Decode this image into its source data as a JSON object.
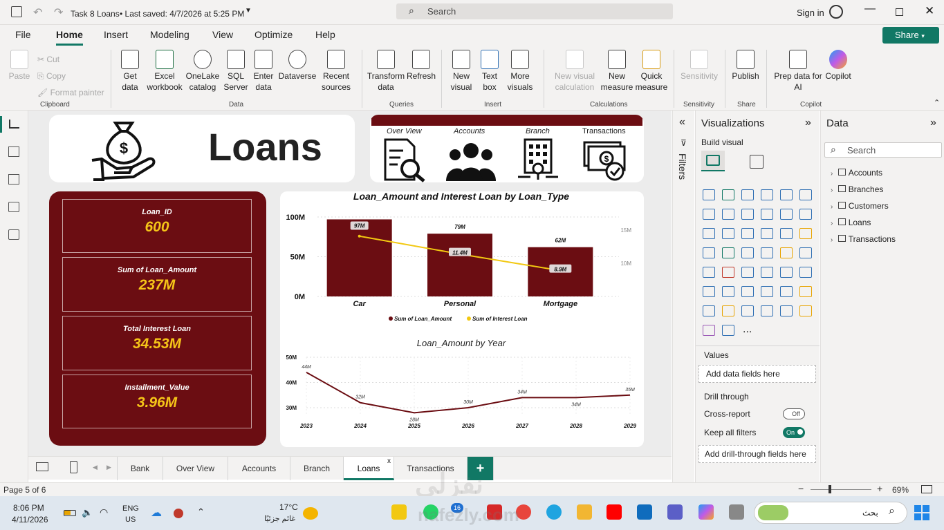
{
  "titlebar": {
    "title": "Task 8 Loans",
    "saved": "• Last saved: 4/7/2026 at 5:25 PM",
    "search": "Search",
    "signin": "Sign in"
  },
  "menu": {
    "items": [
      "File",
      "Home",
      "Insert",
      "Modeling",
      "View",
      "Optimize",
      "Help"
    ],
    "share": "Share"
  },
  "ribbon": {
    "clipboard": {
      "paste": "Paste",
      "cut": "Cut",
      "copy": "Copy",
      "format_painter": "Format painter",
      "group": "Clipboard"
    },
    "data": {
      "get_data": "Get data",
      "excel": "Excel workbook",
      "onelake": "OneLake catalog",
      "sql": "SQL Server",
      "enter": "Enter data",
      "dataverse": "Dataverse",
      "recent": "Recent sources",
      "group": "Data"
    },
    "queries": {
      "transform": "Transform data",
      "refresh": "Refresh",
      "group": "Queries"
    },
    "insert": {
      "new_visual": "New visual",
      "text_box": "Text box",
      "more_visuals": "More visuals",
      "group": "Insert"
    },
    "calculations": {
      "new_visual_calc": "New visual calculation",
      "new_measure": "New measure",
      "quick_measure": "Quick measure",
      "group": "Calculations"
    },
    "sensitivity": {
      "label": "Sensitivity",
      "group": "Sensitivity"
    },
    "share": {
      "publish": "Publish",
      "group": "Share"
    },
    "copilot": {
      "prep": "Prep data for AI",
      "copilot": "Copilot",
      "group": "Copilot"
    }
  },
  "report": {
    "title": "Loans",
    "nav": {
      "bar_color": "#6b0d12",
      "items": [
        "Over View",
        "Accounts",
        "Branch",
        "Transactions"
      ]
    },
    "cards": [
      {
        "label": "Loan_ID",
        "value": "600"
      },
      {
        "label": "Sum of Loan_Amount",
        "value": "237M"
      },
      {
        "label": "Total Interest Loan",
        "value": "34.53M"
      },
      {
        "label": "Installment_Value",
        "value": "3.96M"
      }
    ]
  },
  "chart_data": [
    {
      "type": "bar",
      "title": "Loan_Amount and Interest Loan by Loan_Type",
      "categories": [
        "Car",
        "Personal",
        "Mortgage"
      ],
      "series": [
        {
          "name": "Sum of Loan_Amount",
          "values": [
            97,
            79,
            62
          ],
          "labels": [
            "97M",
            "79M",
            "62M"
          ],
          "color": "#6b0d12"
        },
        {
          "name": "Sum of Interest Loan",
          "values": [
            14.1,
            11.4,
            8.9
          ],
          "labels": [
            "",
            "11.4M",
            "8.9M"
          ],
          "color": "#f2c811"
        }
      ],
      "y_ticks": [
        "100M",
        "50M",
        "0M"
      ],
      "ylim": [
        0,
        100
      ],
      "y2_ticks": [
        "15M",
        "10M"
      ],
      "y2lim": [
        5,
        17
      ],
      "legend": "bottom"
    },
    {
      "type": "line",
      "title": "Loan_Amount by Year",
      "x": [
        "2023",
        "2024",
        "2025",
        "2026",
        "2027",
        "2028",
        "2029"
      ],
      "values": [
        44,
        32,
        28,
        30,
        34,
        34,
        35
      ],
      "labels": [
        "44M",
        "32M",
        "28M",
        "30M",
        "34M",
        "34M",
        "35M"
      ],
      "color": "#6b0d12",
      "y_ticks": [
        "50M",
        "40M",
        "30M"
      ],
      "ylim": [
        27,
        50
      ]
    }
  ],
  "filters": {
    "label": "Filters"
  },
  "visualizations": {
    "title": "Visualizations",
    "build": "Build visual",
    "values": "Values",
    "values_placeholder": "Add data fields here",
    "drill": "Drill through",
    "cross_report": "Cross-report",
    "cross_state": "Off",
    "keep_filters": "Keep all filters",
    "keep_state": "On",
    "drill_placeholder": "Add drill-through fields here",
    "more": "..."
  },
  "datapane": {
    "title": "Data",
    "search": "Search",
    "tables": [
      "Accounts",
      "Branches",
      "Customers",
      "Loans",
      "Transactions"
    ]
  },
  "tabs": {
    "items": [
      "Bank",
      "Over View",
      "Accounts",
      "Branch",
      "Loans",
      "Transactions"
    ],
    "active": "Loans",
    "add": "+"
  },
  "status": {
    "page": "Page 5 of 6",
    "zoom": "69%",
    "zoom_value": 0.69
  },
  "taskbar": {
    "time": "8:06 PM",
    "date": "4/11/2026",
    "lang1": "ENG",
    "lang2": "US",
    "temp": "17°C",
    "weather": "غائم جزئيًا",
    "search": "بحث",
    "badge": "16"
  },
  "watermark": {
    "arabic": "نفزلي",
    "latin": "nafezly.com"
  }
}
